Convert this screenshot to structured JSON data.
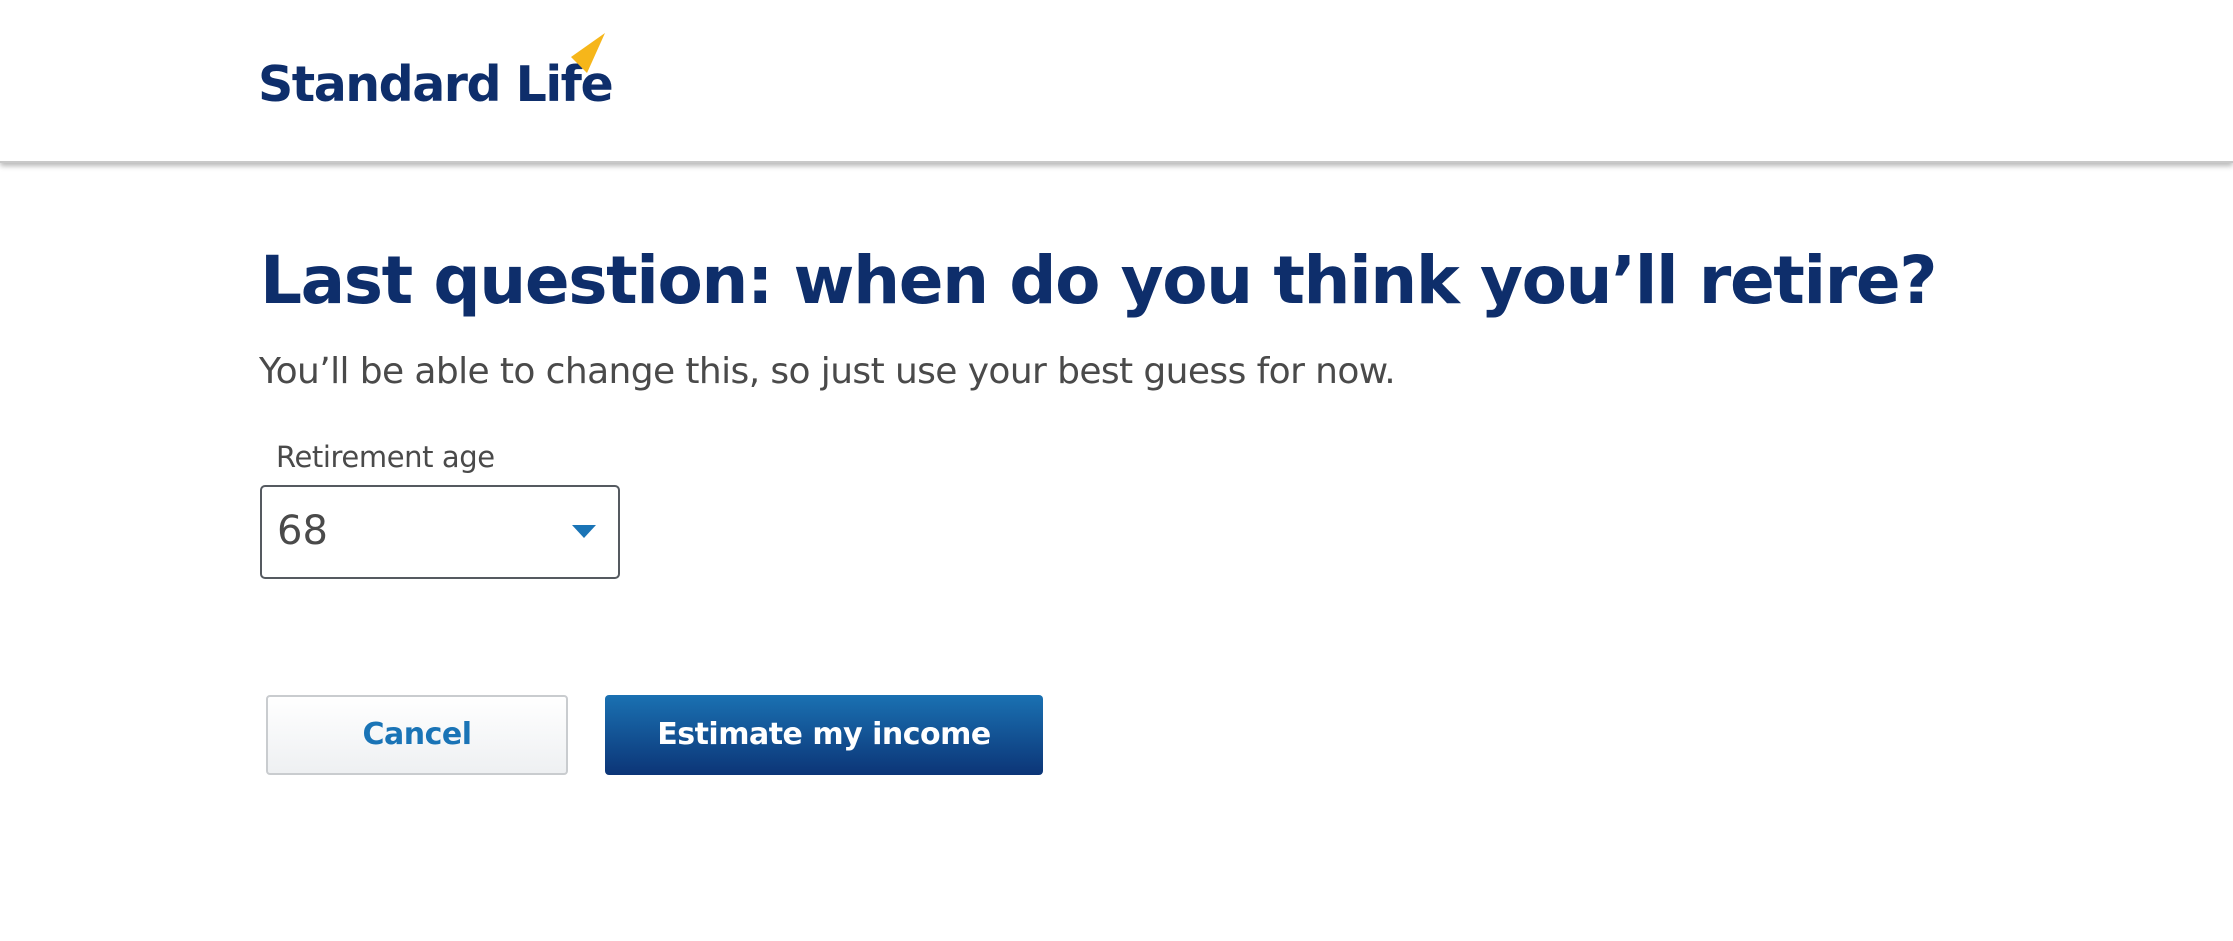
{
  "brand": {
    "name": "Standard Life",
    "text_color": "#0e2e6b",
    "mark_color": "#f6b61a",
    "mark_icon": "brand-flag-icon"
  },
  "page": {
    "title": "Last question: when do you think you’ll retire?",
    "subtitle": "You’ll be able to change this, so just use your best guess for now."
  },
  "form": {
    "retirement_age": {
      "label": "Retirement age",
      "value": "68",
      "icon": "chevron-down-icon"
    }
  },
  "actions": {
    "cancel_label": "Cancel",
    "submit_label": "Estimate my income"
  },
  "colors": {
    "accent": "#1a74b6",
    "primary_button_top": "#1a71b2",
    "primary_button_bottom": "#0c3577",
    "body_text": "#4a4a4a"
  }
}
